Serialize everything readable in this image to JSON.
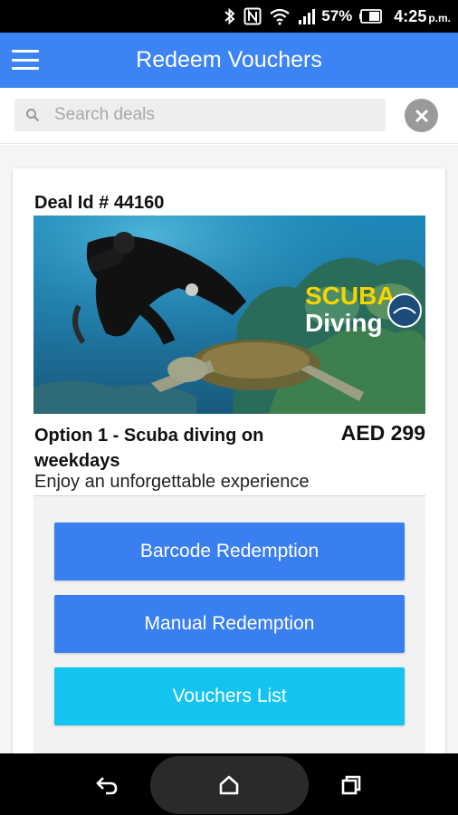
{
  "status_bar": {
    "battery_percent": "57%",
    "time": "4:25",
    "ampm": "p.m.",
    "icons": [
      "bluetooth-icon",
      "nfc-icon",
      "wifi-icon",
      "signal-icon",
      "battery-icon"
    ]
  },
  "app_bar": {
    "title": "Redeem Vouchers",
    "menu_icon": "hamburger-menu-icon"
  },
  "search": {
    "placeholder": "Search deals",
    "value": "",
    "clear_icon": "close-icon"
  },
  "deal": {
    "id_label": "Deal Id # 44160",
    "image_text_line1": "SCUBA",
    "image_text_line2": "Diving",
    "option_title": "Option 1 - Scuba diving on weekdays",
    "price": "AED 299",
    "subtitle": "Enjoy an unforgettable experience"
  },
  "actions": {
    "barcode_label": "Barcode Redemption",
    "manual_label": "Manual Redemption",
    "vouchers_label": "Vouchers List"
  },
  "nav_bar": {
    "icons": [
      "back-icon",
      "home-icon",
      "recents-icon"
    ]
  },
  "colors": {
    "primary": "#3c83f3",
    "button_primary": "#3a7ff0",
    "button_secondary": "#14c4f0"
  }
}
